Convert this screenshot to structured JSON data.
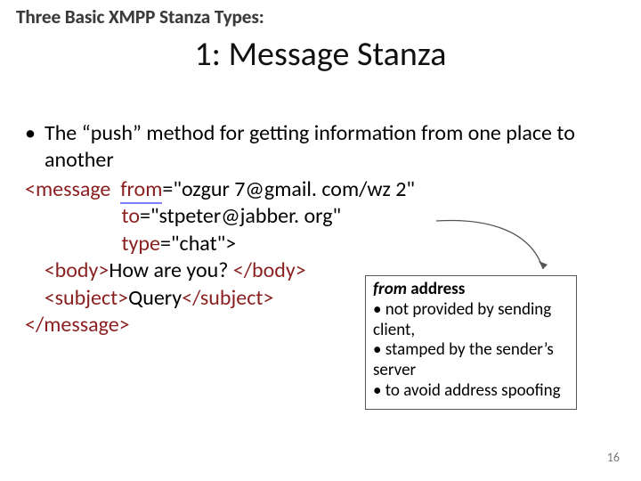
{
  "supertitle": "Three Basic XMPP Stanza Types:",
  "title": "1: Message Stanza",
  "bullet": "The “push” method for getting information from one place to another",
  "code": {
    "open_tag": "<message",
    "from_attr": "from",
    "from_val": "=\"ozgur 7@gmail. com/wz 2\"",
    "to_attr": "to",
    "to_val": "=\"stpeter@jabber. org\"",
    "type_attr": "type",
    "type_val": "=\"chat\">",
    "body_open": "<body>",
    "body_text": "How are you? ",
    "body_close": "</body>",
    "subject_open": "<subject>",
    "subject_text": "Query",
    "subject_close": "</subject>",
    "close_tag": "</message>"
  },
  "callout": {
    "header_em": "from",
    "header_rest": " address",
    "lines": [
      "• not provided by sending client,",
      "• stamped by the sender’s server",
      "• to avoid address spoofing"
    ]
  },
  "page_number": "16"
}
